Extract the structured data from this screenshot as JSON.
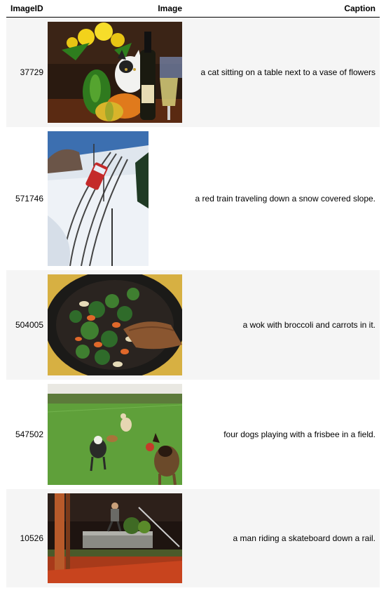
{
  "table": {
    "headers": {
      "image_id": "ImageID",
      "image": "Image",
      "caption": "Caption"
    },
    "rows": [
      {
        "image_id": "37729",
        "image_subject": "cat-flowers-photo",
        "caption": "a cat sitting on a table next to a vase of flowers"
      },
      {
        "image_id": "571746",
        "image_subject": "snow-train-photo",
        "caption": "a red train traveling down a snow covered slope."
      },
      {
        "image_id": "504005",
        "image_subject": "wok-broccoli-photo",
        "caption": "a wok with broccoli and carrots in it."
      },
      {
        "image_id": "547502",
        "image_subject": "dogs-field-photo",
        "caption": "four dogs playing with a frisbee in a field."
      },
      {
        "image_id": "10526",
        "image_subject": "skateboard-rail-photo",
        "caption": "a man riding a skateboard down a rail."
      }
    ]
  }
}
